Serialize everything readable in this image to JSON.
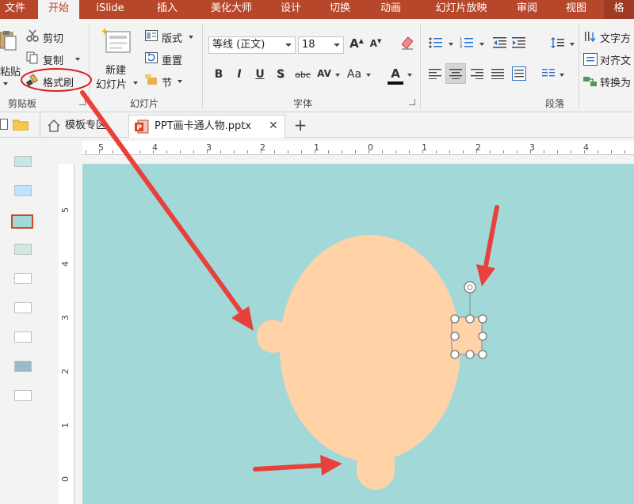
{
  "ribbon_tabs": [
    {
      "label": "文件",
      "active": false
    },
    {
      "label": "开始",
      "active": true
    },
    {
      "label": "iSlide",
      "active": false
    },
    {
      "label": "插入",
      "active": false
    },
    {
      "label": "美化大师",
      "active": false
    },
    {
      "label": "设计",
      "active": false
    },
    {
      "label": "切换",
      "active": false
    },
    {
      "label": "动画",
      "active": false
    },
    {
      "label": "幻灯片放映",
      "active": false
    },
    {
      "label": "审阅",
      "active": false
    },
    {
      "label": "视图",
      "active": false
    },
    {
      "label": "格",
      "active": false
    }
  ],
  "clipboard": {
    "paste_label": "粘贴",
    "cut_label": "剪切",
    "copy_label": "复制",
    "format_painter_label": "格式刷",
    "group_label": "剪贴板"
  },
  "slides_group": {
    "new_slide_line1": "新建",
    "new_slide_line2": "幻灯片",
    "layout_label": "版式",
    "reset_label": "重置",
    "section_label": "节",
    "group_label": "幻灯片"
  },
  "font_group": {
    "font_name": "等线 (正文)",
    "font_size": "18",
    "bold": "B",
    "italic": "I",
    "underline": "U",
    "shadow": "S",
    "strikethrough": "abc",
    "char_spacing": "AV",
    "change_case": "Aa",
    "font_color": "A",
    "grow": "A",
    "shrink": "A",
    "group_label": "字体"
  },
  "paragraph_group": {
    "text_direction_label": "文字方",
    "align_text_label": "对齐文",
    "convert_label": "转换为",
    "group_label": "段落"
  },
  "doc_tabs": {
    "template_tab_label": "模板专区",
    "file_tab_label": "PPT画卡通人物.pptx",
    "close_glyph": "✕",
    "add_glyph": "+"
  },
  "ruler": {
    "h_numbers": [
      "5",
      "4",
      "3",
      "2",
      "1",
      "0",
      "1",
      "2",
      "3",
      "4"
    ],
    "v_numbers": [
      "5",
      "4",
      "3",
      "2",
      "1",
      "0"
    ]
  },
  "colors": {
    "ribbon_accent": "#b7472a",
    "slide_background": "#a3d8d8",
    "skin": "#ffd2a8",
    "annotation_arrow": "#e8413c",
    "annotation_circle": "#d81e1e"
  }
}
